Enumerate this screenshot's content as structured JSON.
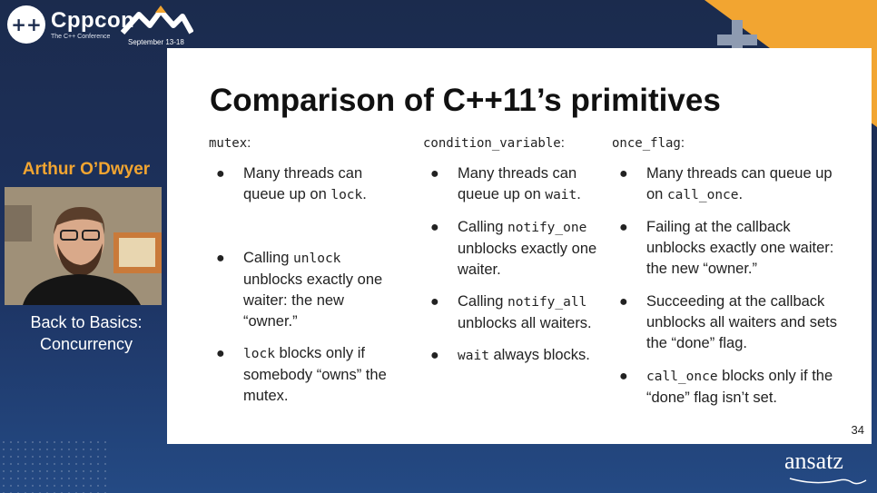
{
  "brand": {
    "logo_mark": "++",
    "name": "Cppcon",
    "subtitle": "The C++ Conference",
    "dates": "September 13-18",
    "accent": "#f2a531",
    "background": "#1d3260"
  },
  "speaker": {
    "name": "Arthur O’Dwyer",
    "talk_line1": "Back to Basics:",
    "talk_line2": "Concurrency"
  },
  "slide": {
    "title": "Comparison of C++11’s primitives",
    "page_number": "34",
    "columns": [
      {
        "header": "mutex",
        "items": [
          {
            "pre": "Many threads can queue up on ",
            "code": "lock",
            "post": "."
          },
          {
            "pre": "Calling ",
            "code": "unlock",
            "post": " unblocks exactly one waiter: the new “owner.”"
          },
          {
            "pre": "",
            "code": "lock",
            "post": " blocks only if somebody “owns” the mutex."
          }
        ]
      },
      {
        "header": "condition_variable",
        "items": [
          {
            "pre": "Many threads can queue up on ",
            "code": "wait",
            "post": "."
          },
          {
            "pre": "Calling ",
            "code": "notify_one",
            "post": " unblocks exactly one waiter."
          },
          {
            "pre": "Calling ",
            "code": "notify_all",
            "post": " unblocks all waiters."
          },
          {
            "pre": "",
            "code": "wait",
            "post": " always blocks."
          }
        ]
      },
      {
        "header": "once_flag",
        "items": [
          {
            "pre": "Many threads can queue up on ",
            "code": "call_once",
            "post": "."
          },
          {
            "pre": "Failing at the callback unblocks exactly one waiter: the new “owner.”",
            "code": "",
            "post": ""
          },
          {
            "pre": "Succeeding at the callback unblocks all waiters and sets the “done” flag.",
            "code": "",
            "post": ""
          },
          {
            "pre": "",
            "code": "call_once",
            "post": " blocks only if the “done” flag isn’t set."
          }
        ]
      }
    ]
  },
  "sponsor": {
    "name": "ansatz"
  }
}
